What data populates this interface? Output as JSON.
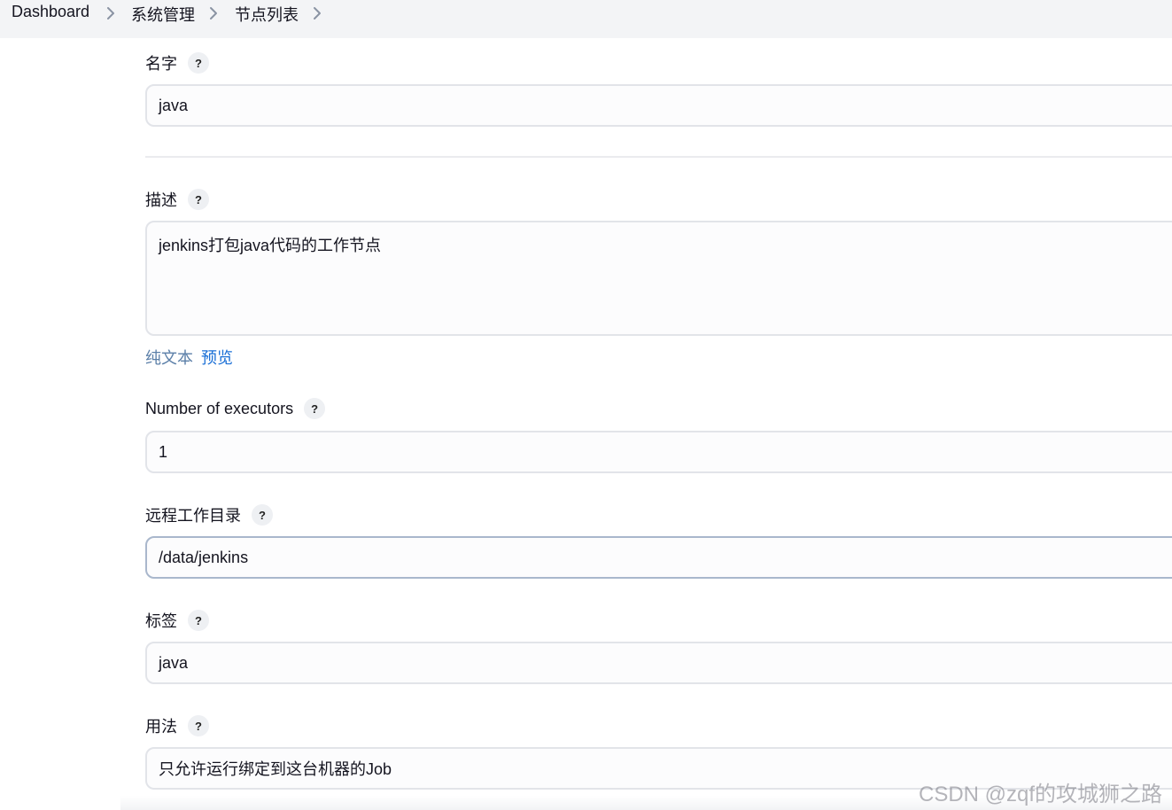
{
  "breadcrumb": {
    "items": [
      "Dashboard",
      "系统管理",
      "节点列表"
    ]
  },
  "help_glyph": "?",
  "form": {
    "name": {
      "label": "名字",
      "value": "java"
    },
    "description": {
      "label": "描述",
      "value": "jenkins打包java代码的工作节点",
      "tab_plain": "纯文本",
      "tab_preview": "预览"
    },
    "executors": {
      "label": "Number of executors",
      "value": "1"
    },
    "remote_dir": {
      "label": "远程工作目录",
      "value": "/data/jenkins"
    },
    "labels": {
      "label": "标签",
      "value": "java"
    },
    "usage": {
      "label": "用法",
      "value": "只允许运行绑定到这台机器的Job"
    }
  },
  "watermark": "CSDN @zqf的攻城狮之路",
  "colors": {
    "link_plain": "#5b7fa8",
    "link_preview": "#1a6fd6",
    "topbar_bg": "#f3f4f6"
  },
  "icons": [
    "chevron-right-icon",
    "help-icon"
  ]
}
